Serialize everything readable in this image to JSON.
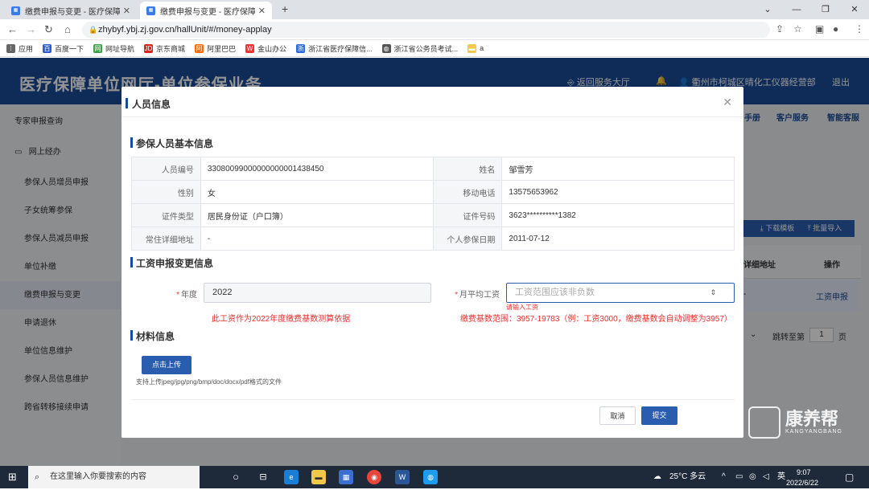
{
  "browser": {
    "tabs": [
      {
        "title": "缴费申报与变更 - 医疗保障单位网厅",
        "active": false
      },
      {
        "title": "缴费申报与变更 - 医疗保障单位网厅",
        "active": true
      }
    ],
    "url": "zhybyf.ybj.zj.gov.cn/hallUnit/#/money-applay",
    "bookmarks": [
      "应用",
      "百度一下",
      "网址导航",
      "京东商城",
      "阿里巴巴",
      "金山办公",
      "浙江省医疗保障信...",
      "浙江省公务员考试...",
      "a"
    ]
  },
  "page": {
    "title": "医疗保障单位网厅-单位参保业务",
    "header_links": [
      "返回服务大厅",
      "衢州市柯城区晴化工仪器经营部",
      "退出"
    ]
  },
  "sidebar": {
    "items": [
      "专家申报查询",
      "网上经办",
      "参保人员增员申报",
      "子女统筹参保",
      "参保人员减员申报",
      "单位补缴",
      "缴费申报与变更",
      "申请退休",
      "单位信息维护",
      "参保人员信息维护",
      "跨省转移接续申请"
    ],
    "active": "缴费申报与变更"
  },
  "behind": {
    "top_links": [
      "手册",
      "客户服务",
      "智能客服"
    ],
    "buttons": [
      "下载模板",
      "批量导入"
    ],
    "columns": [
      "详细地址",
      "操作"
    ],
    "row_action": "工资申报",
    "row_dash": "-",
    "pager_goto": "跳转至第",
    "pager_page": "1",
    "pager_unit": "页"
  },
  "modal": {
    "title": "人员信息",
    "section_basic": "参保人员基本信息",
    "basic": [
      {
        "label": "人员编号",
        "value": "33080099000000000001438450",
        "label2": "姓名",
        "value2": "邹雪芳"
      },
      {
        "label": "性别",
        "value": "女",
        "label2": "移动电话",
        "value2": "13575653962"
      },
      {
        "label": "证件类型",
        "value": "居民身份证（户口簿）",
        "label2": "证件号码",
        "value2": "3623**********1382"
      },
      {
        "label": "常住详细地址",
        "value": "-",
        "label2": "个人参保日期",
        "value2": "2011-07-12"
      }
    ],
    "section_wage": "工资申报变更信息",
    "year_label": "年度",
    "year_value": "2022",
    "wage_label": "月平均工资",
    "wage_placeholder": "工资范围应该非负数",
    "wage_error": "请输入工资",
    "year_note": "此工资作为2022年度缴费基数测算依据",
    "wage_note": "缴费基数范围：3957-19783（例：工资3000，缴费基数会自动调整为3957）",
    "section_material": "材料信息",
    "upload_button": "点击上传",
    "upload_hint": "支持上传jpeg/jpg/png/bmp/doc/docx/pdf格式的文件",
    "cancel_button": "取消",
    "submit_button": "提交"
  },
  "watermark": {
    "cn": "康养帮",
    "en": "KANGYANGBANG"
  },
  "taskbar": {
    "search_placeholder": "在这里输入你要搜索的内容",
    "weather": "25°C 多云",
    "ime": "英",
    "time": "9:07",
    "date": "2022/6/22"
  },
  "colors": {
    "primary": "#1b4c99",
    "button": "#2a5db0",
    "error": "#e62e2e"
  }
}
